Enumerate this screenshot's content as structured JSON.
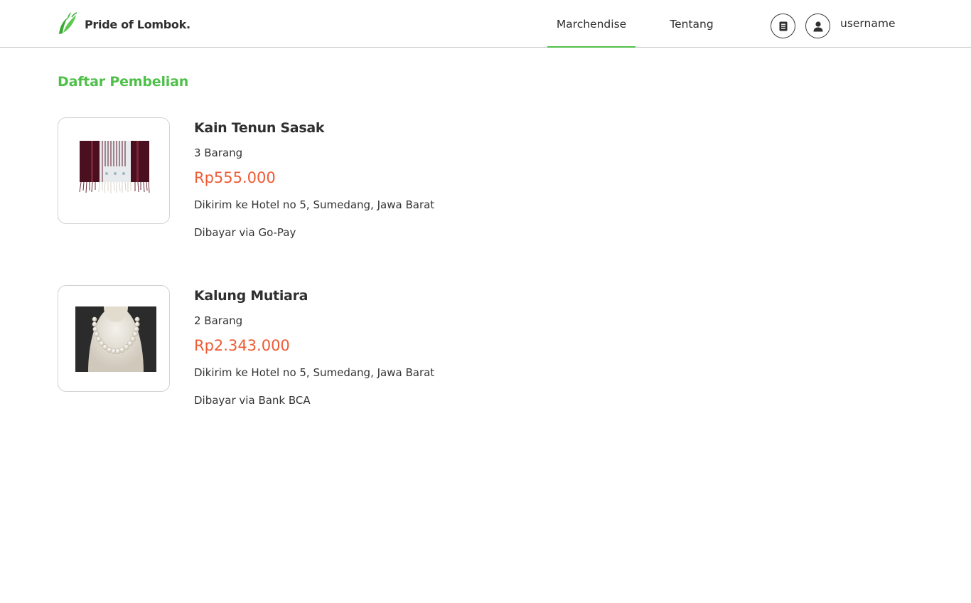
{
  "header": {
    "brand_name": "Pride of Lombok.",
    "nav": [
      {
        "label": "Marchendise",
        "active": true
      },
      {
        "label": "Tentang",
        "active": false
      }
    ],
    "username": "username"
  },
  "colors": {
    "accent": "#4fbf4a",
    "price": "#ef5a34",
    "text": "#2f2f2f"
  },
  "icons": {
    "brand": "leaf-logo-icon",
    "orders": "receipt-icon",
    "avatar": "user-icon"
  },
  "main": {
    "title": "Daftar Pembelian",
    "purchases": [
      {
        "name": "Kain Tenun Sasak",
        "quantity": "3 Barang",
        "price": "Rp555.000",
        "shipping": "Dikirim ke Hotel no 5, Sumedang, Jawa Barat",
        "payment": "Dibayar via Go-Pay"
      },
      {
        "name": "Kalung Mutiara",
        "quantity": "2 Barang",
        "price": "Rp2.343.000",
        "shipping": "Dikirim ke Hotel no 5, Sumedang, Jawa Barat",
        "payment": "Dibayar via Bank BCA"
      }
    ]
  }
}
